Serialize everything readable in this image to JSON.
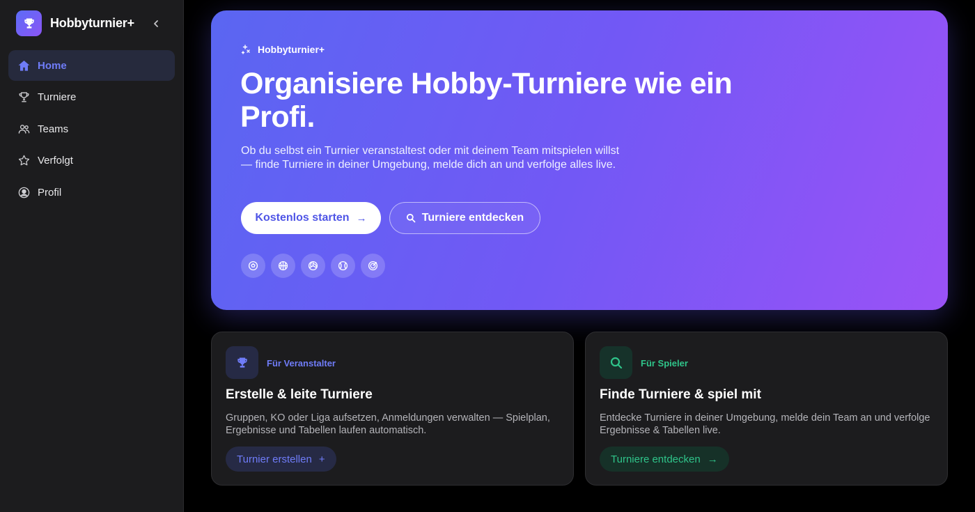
{
  "sidebar": {
    "brand": "Hobbyturnier+",
    "items": [
      {
        "label": "Home",
        "icon": "home-icon",
        "active": true
      },
      {
        "label": "Turniere",
        "icon": "trophy-icon"
      },
      {
        "label": "Teams",
        "icon": "users-icon"
      },
      {
        "label": "Verfolgt",
        "icon": "star-icon"
      },
      {
        "label": "Profil",
        "icon": "user-circle-icon"
      }
    ]
  },
  "hero": {
    "tag": "Hobbyturnier+",
    "title": "Organisiere Hobby-Turniere wie ein Profi.",
    "description": "Ob du selbst ein Turnier veranstaltest oder mit deinem Team mitspielen willst — finde Turniere in deiner Umgebung, melde dich an und verfolge alles live.",
    "primary_button": "Kostenlos starten",
    "secondary_button": "Turniere entdecken",
    "sport_icons": [
      "soccer-ball-icon",
      "basketball-icon",
      "volleyball-icon",
      "tennis-ball-icon",
      "target-icon"
    ]
  },
  "cards": {
    "organizer": {
      "tag": "Für Veranstalter",
      "title": "Erstelle & leite Turniere",
      "description": "Gruppen, KO oder Liga aufsetzen, Anmeldungen verwalten — Spielplan, Ergebnisse und Tabellen laufen automatisch.",
      "button": "Turnier erstellen",
      "button_icon": "+"
    },
    "player": {
      "tag": "Für Spieler",
      "title": "Finde Turniere & spiel mit",
      "description": "Entdecke Turniere in deiner Umgebung, melde dein Team an und verfolge Ergebnisse & Tabellen live.",
      "button": "Turniere entdecken",
      "button_icon": "→"
    }
  },
  "colors": {
    "accent": "#6f7cf8",
    "green": "#2fc48a",
    "hero_gradient_start": "#5a66f2",
    "hero_gradient_end": "#9a52f6",
    "sidebar_bg": "#1c1c1e"
  }
}
